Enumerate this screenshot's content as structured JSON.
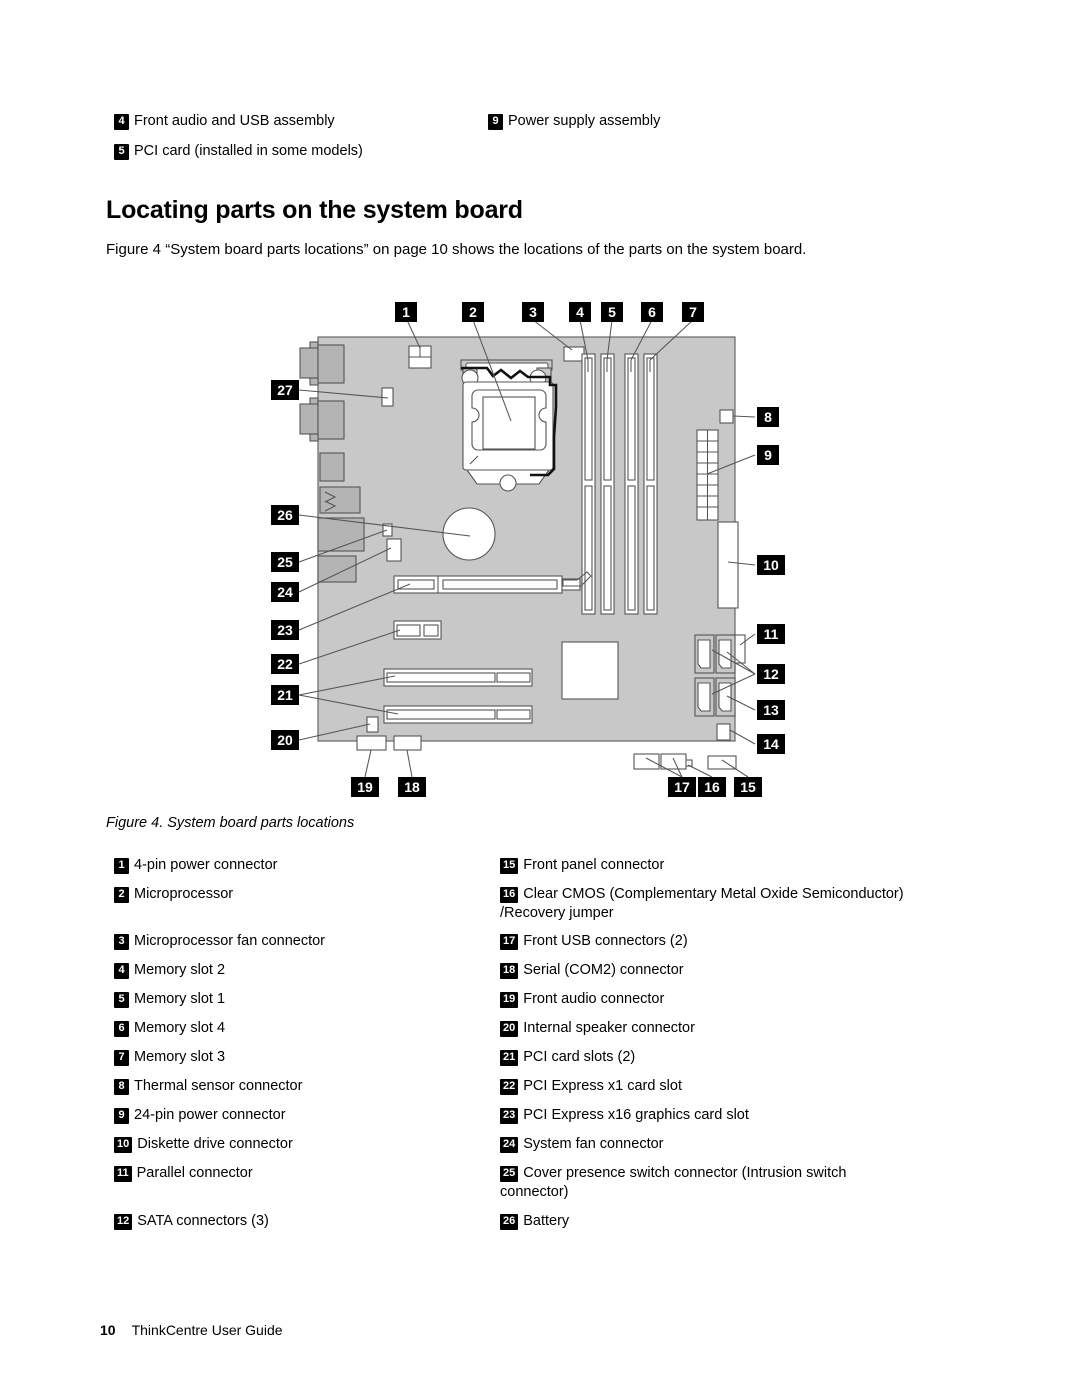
{
  "top_continued_list": [
    {
      "num": "4",
      "label": "Front audio and USB assembly",
      "col": "a",
      "row": 0
    },
    {
      "num": "9",
      "label": "Power supply assembly",
      "col": "b",
      "row": 0
    },
    {
      "num": "5",
      "label": "PCI card (installed in some models)",
      "col": "a",
      "row": 1
    }
  ],
  "heading": "Locating parts on the system board",
  "intro": "Figure 4 “System board parts locations” on page 10 shows the locations of the parts on the system board.",
  "figure": {
    "caption": "Figure 4. System board parts locations",
    "callouts_top": [
      "1",
      "2",
      "3",
      "4",
      "5",
      "6",
      "7"
    ],
    "callouts_right": [
      "8",
      "9",
      "10",
      "11",
      "12",
      "13",
      "14"
    ],
    "callouts_bottom": [
      "19",
      "18",
      "17",
      "16",
      "15"
    ],
    "callouts_left": [
      "27",
      "26",
      "25",
      "24",
      "23",
      "22",
      "21",
      "20"
    ],
    "board_color": "#c8c8c8",
    "outline_color": "#4d4d4d",
    "slot_color": "#ffffff"
  },
  "parts": {
    "left_column": [
      {
        "num": "1",
        "label": "4-pin power connector"
      },
      {
        "num": "2",
        "label": "Microprocessor"
      },
      {
        "num": "3",
        "label": "Microprocessor fan connector"
      },
      {
        "num": "4",
        "label": "Memory slot 2"
      },
      {
        "num": "5",
        "label": "Memory slot 1"
      },
      {
        "num": "6",
        "label": "Memory slot 4"
      },
      {
        "num": "7",
        "label": "Memory slot 3"
      },
      {
        "num": "8",
        "label": "Thermal sensor connector"
      },
      {
        "num": "9",
        "label": "24-pin power connector"
      },
      {
        "num": "10",
        "label": "Diskette drive connector"
      },
      {
        "num": "11",
        "label": "Parallel connector"
      },
      {
        "num": "12",
        "label": "SATA connectors (3)"
      }
    ],
    "right_column": [
      {
        "num": "15",
        "label": "Front panel connector"
      },
      {
        "num": "16",
        "label": "Clear CMOS (Complementary Metal Oxide Semiconductor)",
        "continuation": "/Recovery jumper"
      },
      {
        "num": "17",
        "label": "Front USB connectors (2)"
      },
      {
        "num": "18",
        "label": "Serial (COM2) connector"
      },
      {
        "num": "19",
        "label": "Front audio connector"
      },
      {
        "num": "20",
        "label": "Internal speaker connector"
      },
      {
        "num": "21",
        "label": "PCI card slots (2)"
      },
      {
        "num": "22",
        "label": "PCI Express x1 card slot"
      },
      {
        "num": "23",
        "label": "PCI Express x16 graphics card slot"
      },
      {
        "num": "24",
        "label": "System fan connector"
      },
      {
        "num": "25",
        "label": "Cover presence switch connector (Intrusion switch",
        "continuation": "connector)"
      },
      {
        "num": "26",
        "label": "Battery"
      }
    ]
  },
  "footer": {
    "page_number": "10",
    "guide_title": "ThinkCentre User Guide"
  }
}
